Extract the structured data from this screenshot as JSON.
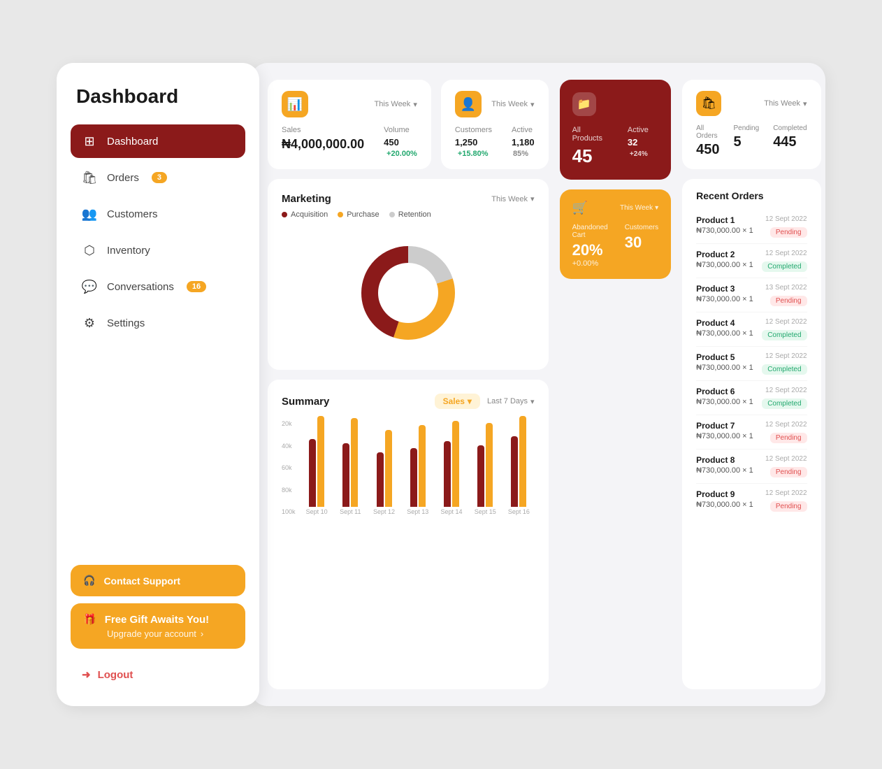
{
  "sidebar": {
    "title": "Dashboard",
    "nav": [
      {
        "id": "dashboard",
        "label": "Dashboard",
        "icon": "⊞",
        "active": true,
        "badge": null
      },
      {
        "id": "orders",
        "label": "Orders",
        "icon": "🛍",
        "active": false,
        "badge": "3"
      },
      {
        "id": "customers",
        "label": "Customers",
        "icon": "👥",
        "active": false,
        "badge": null
      },
      {
        "id": "inventory",
        "label": "Inventory",
        "icon": "⬡",
        "active": false,
        "badge": null
      },
      {
        "id": "conversations",
        "label": "Conversations",
        "icon": "💬",
        "active": false,
        "badge": "16"
      },
      {
        "id": "settings",
        "label": "Settings",
        "icon": "⚙",
        "active": false,
        "badge": null
      }
    ],
    "contact_support": "Contact Support",
    "gift_title": "Free Gift Awaits You!",
    "gift_sub": "Upgrade your account",
    "logout": "Logout"
  },
  "stats": {
    "sales": {
      "week_label": "This Week",
      "sales_label": "Sales",
      "volume_label": "Volume",
      "sales_value": "₦4,000,000.00",
      "volume_value": "450",
      "volume_change": "+20.00%"
    },
    "customers": {
      "week_label": "This Week",
      "customers_label": "Customers",
      "active_label": "Active",
      "customers_value": "1,250",
      "customers_change": "+15.80%",
      "active_value": "1,180",
      "active_pct": "85%"
    },
    "orders": {
      "week_label": "This Week",
      "all_label": "All Orders",
      "pending_label": "Pending",
      "completed_label": "Completed",
      "all_value": "450",
      "pending_value": "5",
      "completed_value": "445"
    }
  },
  "marketing": {
    "title": "Marketing",
    "week_label": "This Week",
    "legend": [
      {
        "label": "Acquisition",
        "color": "#8B1A1A"
      },
      {
        "label": "Purchase",
        "color": "#F5A623"
      },
      {
        "label": "Retention",
        "color": "#ccc"
      }
    ],
    "donut": {
      "acquisition_pct": 45,
      "purchase_pct": 35,
      "retention_pct": 20
    }
  },
  "products": {
    "all_label": "All Products",
    "active_label": "Active",
    "all_value": "45",
    "active_value": "32",
    "active_change": "+24%"
  },
  "cart": {
    "week_label": "This Week",
    "abandoned_label": "Abandoned Cart",
    "customers_label": "Customers",
    "abandoned_value": "20%",
    "abandoned_change": "+0.00%",
    "customers_value": "30"
  },
  "summary": {
    "title": "Summary",
    "sales_tag": "Sales",
    "period": "Last 7 Days",
    "y_labels": [
      "100k",
      "80k",
      "60k",
      "40k",
      "20k"
    ],
    "bars": [
      {
        "label": "Sept 10",
        "dark": 75,
        "yellow": 100
      },
      {
        "label": "Sept 11",
        "dark": 70,
        "yellow": 98
      },
      {
        "label": "Sept 12",
        "dark": 60,
        "yellow": 85
      },
      {
        "label": "Sept 13",
        "dark": 65,
        "yellow": 90
      },
      {
        "label": "Sept 14",
        "dark": 72,
        "yellow": 95
      },
      {
        "label": "Sept 15",
        "dark": 68,
        "yellow": 92
      },
      {
        "label": "Sept 16",
        "dark": 78,
        "yellow": 100
      }
    ]
  },
  "recent_orders": {
    "title": "Recent Orders",
    "orders": [
      {
        "name": "Product 1",
        "price": "₦730,000.00 × 1",
        "date": "12 Sept 2022",
        "status": "Pending"
      },
      {
        "name": "Product 2",
        "price": "₦730,000.00 × 1",
        "date": "12 Sept 2022",
        "status": "Completed"
      },
      {
        "name": "Product 3",
        "price": "₦730,000.00 × 1",
        "date": "13 Sept 2022",
        "status": "Pending"
      },
      {
        "name": "Product 4",
        "price": "₦730,000.00 × 1",
        "date": "12 Sept 2022",
        "status": "Completed"
      },
      {
        "name": "Product 5",
        "price": "₦730,000.00 × 1",
        "date": "12 Sept 2022",
        "status": "Completed"
      },
      {
        "name": "Product 6",
        "price": "₦730,000.00 × 1",
        "date": "12 Sept 2022",
        "status": "Completed"
      },
      {
        "name": "Product 7",
        "price": "₦730,000.00 × 1",
        "date": "12 Sept 2022",
        "status": "Pending"
      },
      {
        "name": "Product 8",
        "price": "₦730,000.00 × 1",
        "date": "12 Sept 2022",
        "status": "Pending"
      },
      {
        "name": "Product 9",
        "price": "₦730,000.00 × 1",
        "date": "12 Sept 2022",
        "status": "Pending"
      }
    ]
  }
}
